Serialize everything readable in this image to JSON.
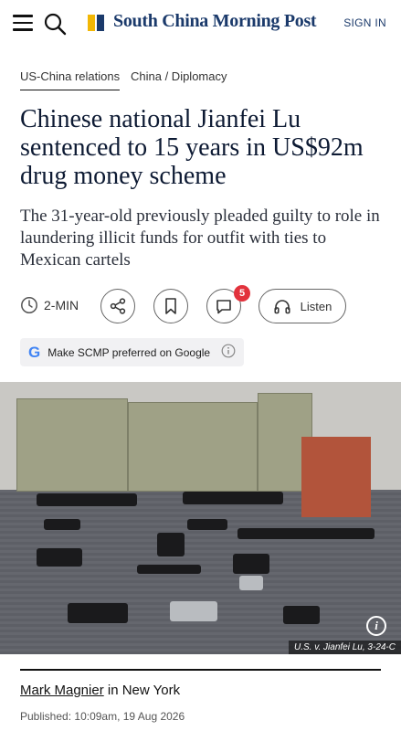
{
  "header": {
    "brand": "South China Morning Post",
    "signin_label": "SIGN IN",
    "icons": {
      "menu": "hamburger-icon",
      "search": "search-icon"
    },
    "brand_colors": {
      "navy": "#1b3a6b",
      "gold": "#f2b705"
    }
  },
  "categories": {
    "primary": "US-China relations",
    "secondary": "China / Diplomacy"
  },
  "article": {
    "headline": "Chinese national Jianfei Lu sentenced to 15 years in US$92m drug money scheme",
    "subheadline": "The 31-year-old previously pleaded guilty to role in laundering illicit funds for outfit with ties to Mexican cartels"
  },
  "actions": {
    "read_time": "2-MIN",
    "comment_count": "5",
    "listen_label": "Listen",
    "icons": [
      "clock-icon",
      "share-icon",
      "bookmark-icon",
      "comment-icon",
      "headphones-icon"
    ],
    "badge_color": "#e2323c"
  },
  "google_pref": {
    "label": "Make SCMP preferred on Google"
  },
  "photo": {
    "caption": "U.S. v. Jianfei Lu, 3-24-C"
  },
  "byline": {
    "author": "Mark Magnier",
    "location_prefix": "in New York",
    "published_label": "Published:",
    "published_time": "10:09am, 19 Aug 2026"
  }
}
